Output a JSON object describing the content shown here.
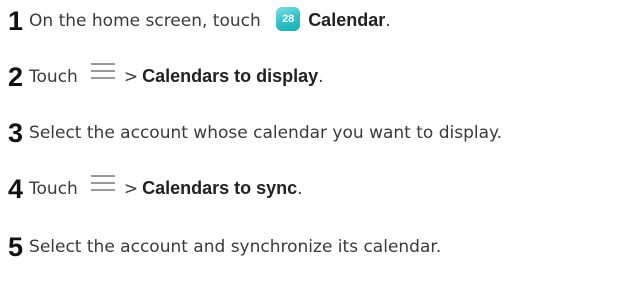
{
  "steps": [
    {
      "number": "1",
      "text_before": "On the home screen, touch",
      "icon": "calendar-app-icon",
      "icon_label": "28",
      "bold": "Calendar",
      "text_after": "."
    },
    {
      "number": "2",
      "text_before": "Touch",
      "icon": "menu-icon",
      "separator": ">",
      "bold": "Calendars to display",
      "text_after": "."
    },
    {
      "number": "3",
      "text": "Select the account whose calendar you want to display."
    },
    {
      "number": "4",
      "text_before": "Touch",
      "icon": "menu-icon",
      "separator": ">",
      "bold": "Calendars to sync",
      "text_after": "."
    },
    {
      "number": "5",
      "text": "Select the account and synchronize its calendar."
    }
  ],
  "colors": {
    "text": "#3a3a3a",
    "number": "#111111",
    "calendar_icon": "#2fc1c7",
    "menu_icon": "#777777"
  }
}
